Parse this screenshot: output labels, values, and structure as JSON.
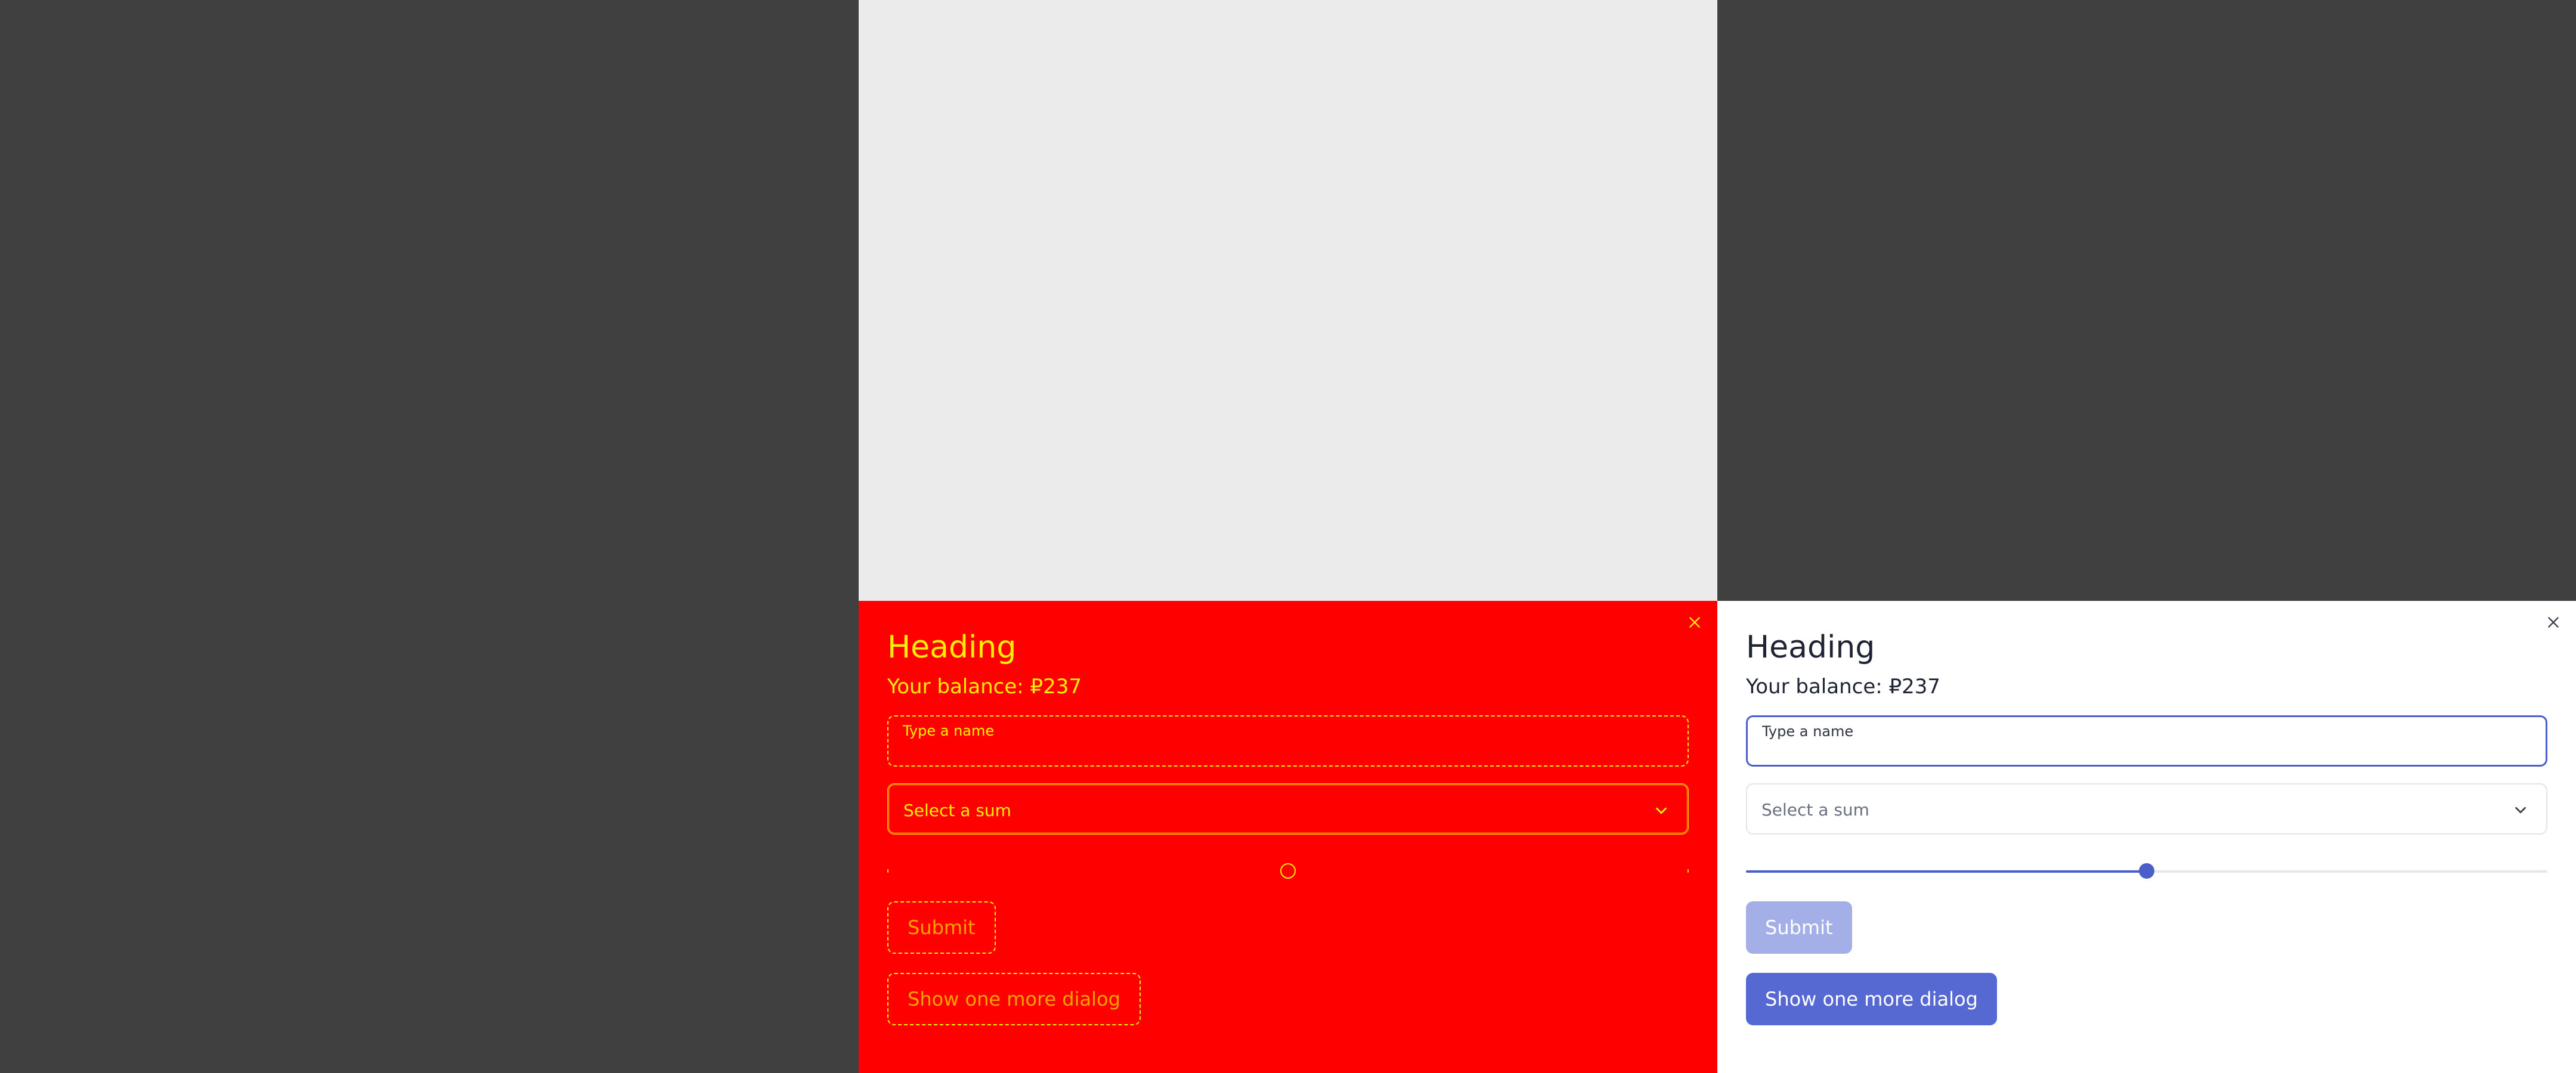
{
  "colors": {
    "page_bg": "#404040",
    "top_panel_bg": "#ebebeb",
    "debug_bg": "#ff0000",
    "debug_fg": "#ffee00",
    "accent": "#5668d2",
    "accent_disabled": "#a3afe6"
  },
  "dialog_debug": {
    "heading": "Heading",
    "balance": "Your balance: ₽237",
    "name_field": {
      "label": "Type a name",
      "value": ""
    },
    "sum_select": {
      "placeholder": "Select a sum"
    },
    "slider": {
      "value_fraction": 0.5
    },
    "submit_label": "Submit",
    "more_label": "Show one more dialog",
    "close_icon": "close-icon"
  },
  "dialog_normal": {
    "heading": "Heading",
    "balance": "Your balance: ₽237",
    "name_field": {
      "label": "Type a name",
      "value": ""
    },
    "sum_select": {
      "placeholder": "Select a sum"
    },
    "slider": {
      "value_fraction": 0.5
    },
    "submit_label": "Submit",
    "more_label": "Show one more dialog",
    "close_icon": "close-icon"
  }
}
